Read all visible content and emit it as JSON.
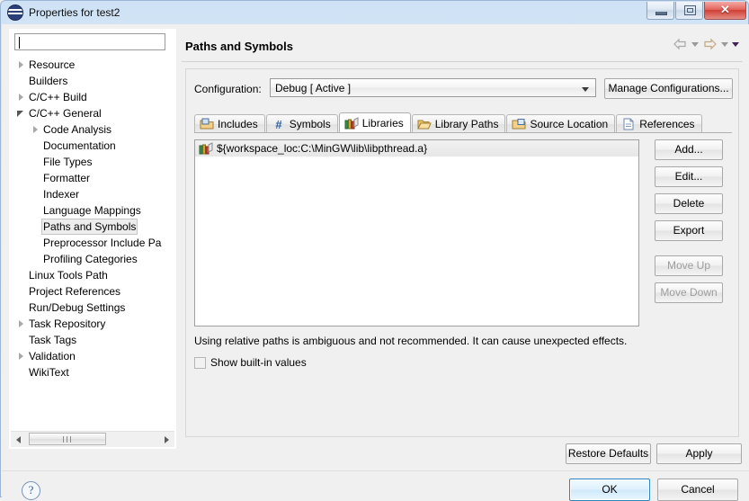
{
  "window": {
    "title": "Properties for test2",
    "icon": "eclipse-icon",
    "buttons": {
      "minimize": "minimize-icon",
      "maximize": "maximize-icon",
      "close": "✕"
    }
  },
  "sidebar": {
    "filter": {
      "value": "",
      "placeholder": ""
    },
    "items": [
      {
        "label": "Resource",
        "indent": 0,
        "twisty": "collapsed",
        "selected": false
      },
      {
        "label": "Builders",
        "indent": 0,
        "twisty": "none",
        "selected": false
      },
      {
        "label": "C/C++ Build",
        "indent": 0,
        "twisty": "collapsed",
        "selected": false
      },
      {
        "label": "C/C++ General",
        "indent": 0,
        "twisty": "expanded",
        "selected": false
      },
      {
        "label": "Code Analysis",
        "indent": 1,
        "twisty": "collapsed",
        "selected": false
      },
      {
        "label": "Documentation",
        "indent": 1,
        "twisty": "none",
        "selected": false
      },
      {
        "label": "File Types",
        "indent": 1,
        "twisty": "none",
        "selected": false
      },
      {
        "label": "Formatter",
        "indent": 1,
        "twisty": "none",
        "selected": false
      },
      {
        "label": "Indexer",
        "indent": 1,
        "twisty": "none",
        "selected": false
      },
      {
        "label": "Language Mappings",
        "indent": 1,
        "twisty": "none",
        "selected": false
      },
      {
        "label": "Paths and Symbols",
        "indent": 1,
        "twisty": "none",
        "selected": true
      },
      {
        "label": "Preprocessor Include Pa",
        "indent": 1,
        "twisty": "none",
        "selected": false
      },
      {
        "label": "Profiling Categories",
        "indent": 1,
        "twisty": "none",
        "selected": false
      },
      {
        "label": "Linux Tools Path",
        "indent": 0,
        "twisty": "none",
        "selected": false
      },
      {
        "label": "Project References",
        "indent": 0,
        "twisty": "none",
        "selected": false
      },
      {
        "label": "Run/Debug Settings",
        "indent": 0,
        "twisty": "none",
        "selected": false
      },
      {
        "label": "Task Repository",
        "indent": 0,
        "twisty": "collapsed",
        "selected": false
      },
      {
        "label": "Task Tags",
        "indent": 0,
        "twisty": "none",
        "selected": false
      },
      {
        "label": "Validation",
        "indent": 0,
        "twisty": "collapsed",
        "selected": false
      },
      {
        "label": "WikiText",
        "indent": 0,
        "twisty": "none",
        "selected": false
      }
    ]
  },
  "header": {
    "title": "Paths and Symbols",
    "nav": {
      "back": "back-arrow-icon",
      "back_menu": "chevron-down-icon",
      "forward": "forward-arrow-icon",
      "forward_menu": "chevron-down-icon",
      "menu": "chevron-down-icon"
    }
  },
  "configuration": {
    "label": "Configuration:",
    "value": "Debug  [ Active ]",
    "manage_label": "Manage Configurations..."
  },
  "tabs": [
    {
      "label": "Includes",
      "icon": "includes-folder-icon",
      "active": false
    },
    {
      "label": "Symbols",
      "icon": "hash-icon",
      "active": false
    },
    {
      "label": "Libraries",
      "icon": "books-icon",
      "active": true
    },
    {
      "label": "Library Paths",
      "icon": "open-folder-icon",
      "active": false
    },
    {
      "label": "Source Location",
      "icon": "source-folder-icon",
      "active": false
    },
    {
      "label": "References",
      "icon": "document-icon",
      "active": false
    }
  ],
  "libraries": {
    "entries": [
      {
        "text": "${workspace_loc:C:\\MinGW\\lib\\libpthread.a}",
        "icon": "books-icon",
        "selected": true
      }
    ],
    "buttons": [
      {
        "label": "Add...",
        "enabled": true,
        "name": "add-button"
      },
      {
        "label": "Edit...",
        "enabled": true,
        "name": "edit-button"
      },
      {
        "label": "Delete",
        "enabled": true,
        "name": "delete-button"
      },
      {
        "label": "Export",
        "enabled": true,
        "name": "export-button"
      },
      {
        "label": "Move Up",
        "enabled": false,
        "name": "move-up-button"
      },
      {
        "label": "Move Down",
        "enabled": false,
        "name": "move-down-button"
      }
    ],
    "note": "Using relative paths is ambiguous and not recommended. It can cause unexpected effects.",
    "show_builtin": {
      "label": "Show built-in values",
      "checked": false
    }
  },
  "actions": {
    "restore_defaults": "Restore Defaults",
    "apply": "Apply",
    "ok": "OK",
    "cancel": "Cancel",
    "help": "?"
  },
  "colors": {
    "title_bar_start": "#cfe2f5",
    "close_button": "#cf3f36",
    "default_button_border": "#2c86c4",
    "selection_gray": "#ededed"
  }
}
